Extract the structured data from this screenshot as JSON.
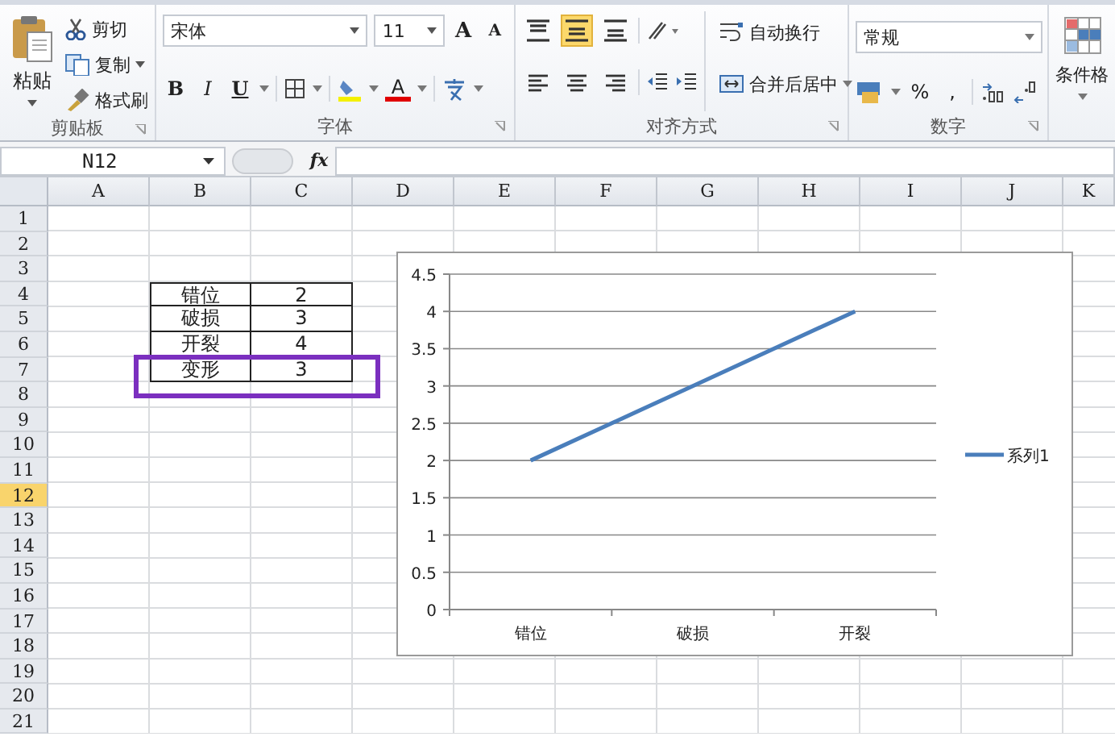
{
  "ribbon": {
    "clipboard": {
      "paste": "粘贴",
      "items": [
        {
          "kind": "cut",
          "label": "剪切"
        },
        {
          "kind": "copy",
          "label": "复制"
        },
        {
          "kind": "painter",
          "label": "格式刷"
        }
      ],
      "label": "剪贴板"
    },
    "font": {
      "name": "宋体",
      "size": "11",
      "grow": "A",
      "shrink": "A",
      "styles": [
        {
          "kind": "bold",
          "label": "B"
        },
        {
          "kind": "italic",
          "label": "I"
        },
        {
          "kind": "underline",
          "label": "U"
        }
      ],
      "color_label": "A",
      "label": "字体"
    },
    "alignment": {
      "vertical": [
        {
          "kind": "top",
          "selected": false
        },
        {
          "kind": "middle",
          "selected": true
        },
        {
          "kind": "bottom",
          "selected": false
        }
      ],
      "horizontal": [
        {
          "kind": "left",
          "selected": false
        },
        {
          "kind": "center",
          "selected": false
        },
        {
          "kind": "right",
          "selected": false
        }
      ],
      "wrap": "自动换行",
      "merge": "合并后居中",
      "label": "对齐方式"
    },
    "number": {
      "format": "常规",
      "percent": "%",
      "comma": ",",
      "label": "数字"
    },
    "styles": {
      "conditional": "条件格"
    }
  },
  "formula_bar": {
    "name_box": "N12",
    "fx": "fx"
  },
  "sheet": {
    "columns": [
      "A",
      "B",
      "C",
      "D",
      "E",
      "F",
      "G",
      "H",
      "I",
      "J",
      "K"
    ],
    "rows": [
      {
        "label": "1",
        "selected": false
      },
      {
        "label": "2",
        "selected": false
      },
      {
        "label": "3",
        "selected": false
      },
      {
        "label": "4",
        "selected": false
      },
      {
        "label": "5",
        "selected": false
      },
      {
        "label": "6",
        "selected": false
      },
      {
        "label": "7",
        "selected": false
      },
      {
        "label": "8",
        "selected": false
      },
      {
        "label": "9",
        "selected": false
      },
      {
        "label": "10",
        "selected": false
      },
      {
        "label": "11",
        "selected": false
      },
      {
        "label": "12",
        "selected": true
      },
      {
        "label": "13",
        "selected": false
      },
      {
        "label": "14",
        "selected": false
      },
      {
        "label": "15",
        "selected": false
      },
      {
        "label": "16",
        "selected": false
      },
      {
        "label": "17",
        "selected": false
      },
      {
        "label": "18",
        "selected": false
      },
      {
        "label": "19",
        "selected": false
      },
      {
        "label": "20",
        "selected": false
      },
      {
        "label": "21",
        "selected": false
      }
    ],
    "table": [
      [
        "错位",
        "2"
      ],
      [
        "破损",
        "3"
      ],
      [
        "开裂",
        "4"
      ],
      [
        "变形",
        "3"
      ]
    ],
    "chart": {
      "chart_data": {
        "type": "line",
        "categories": [
          "错位",
          "破损",
          "开裂"
        ],
        "series": [
          {
            "name": "系列1",
            "color": "#4a7ebb",
            "values": [
              2,
              3,
              4
            ]
          }
        ],
        "grid": true,
        "ylim": [
          0,
          4.5
        ],
        "yticks": [
          0,
          0.5,
          1,
          1.5,
          2,
          2.5,
          3,
          3.5,
          4,
          4.5
        ]
      }
    }
  }
}
